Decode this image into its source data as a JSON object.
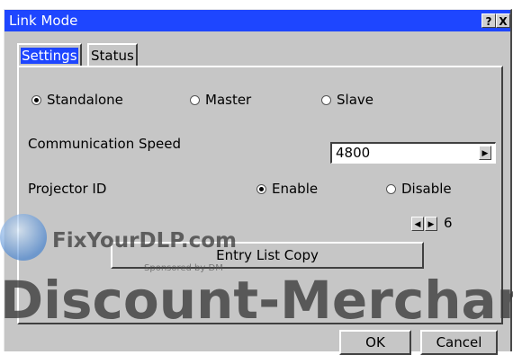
{
  "window": {
    "title": "Link Mode",
    "help_btn": "?",
    "close_btn": "X"
  },
  "tabs": [
    {
      "label": "Settings",
      "active": true
    },
    {
      "label": "Status",
      "active": false
    }
  ],
  "mode": {
    "options": [
      "Standalone",
      "Master",
      "Slave"
    ],
    "selected": "Standalone"
  },
  "communication_speed": {
    "label": "Communication Speed",
    "value": "4800"
  },
  "projector_id": {
    "label": "Projector ID",
    "options": [
      "Enable",
      "Disable"
    ],
    "selected": "Enable",
    "value": "6"
  },
  "buttons": {
    "entry_list_copy": "Entry List Copy",
    "ok": "OK",
    "cancel": "Cancel"
  },
  "watermark": {
    "line1": "FixYourDLP.com",
    "sponsored": "Sponsored by DM",
    "line2": "Discount-Merchan"
  },
  "colors": {
    "accent": "#1e46ff",
    "face": "#c6c6c6"
  }
}
